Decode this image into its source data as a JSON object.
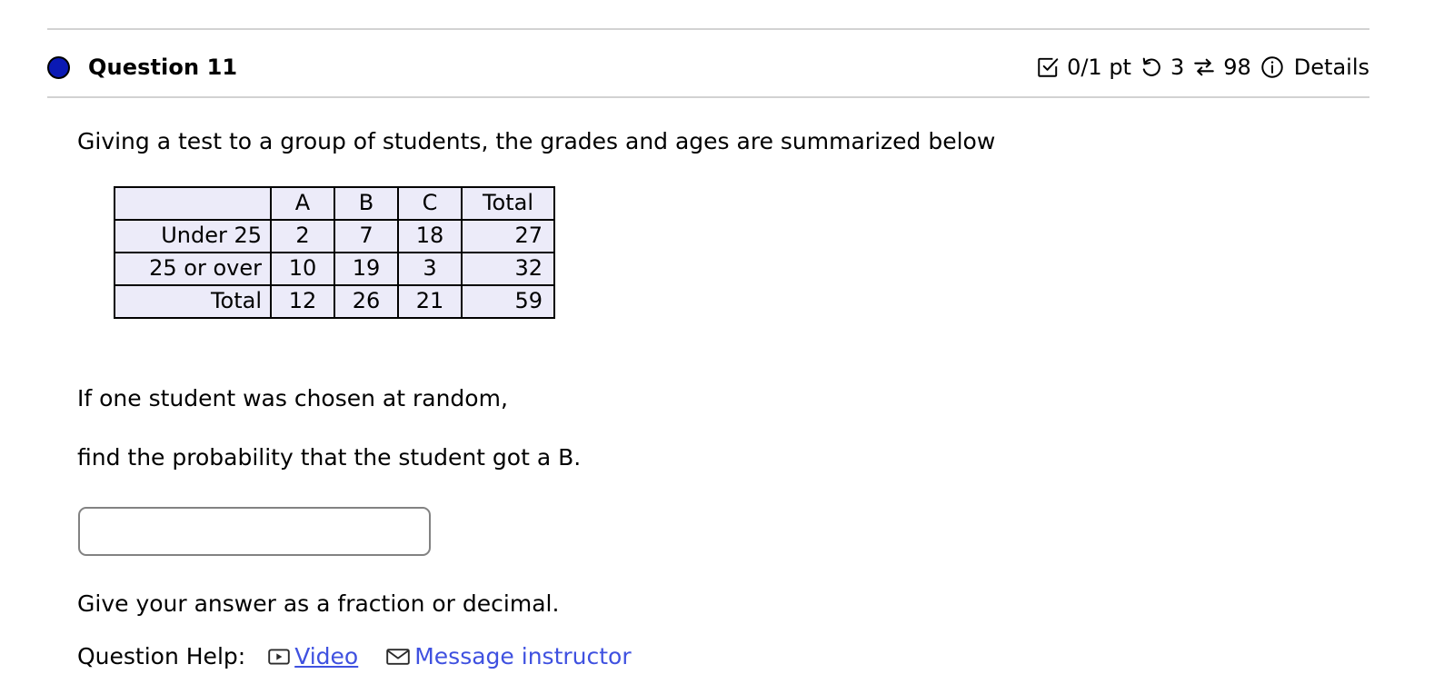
{
  "header": {
    "bullet_color": "#0a19b4",
    "title": "Question 11",
    "score": "0/1 pt",
    "attempts": "3",
    "views": "98",
    "details_label": "Details",
    "icons": {
      "score": "checkbox-checked-icon",
      "attempts": "undo-circular-arrow-icon",
      "views": "exchange-arrows-icon",
      "details": "info-circle-icon"
    }
  },
  "body": {
    "prompt": "Giving a test to a group of students, the grades and ages are summarized below",
    "question_line_1": "If one student was chosen at random,",
    "question_line_2": "find the probability that the student got a B.",
    "hint": "Give your answer as a fraction or decimal."
  },
  "table": {
    "cell_background": "#ecebf9",
    "corner": "",
    "columns": [
      "A",
      "B",
      "C",
      "Total"
    ],
    "rows": [
      {
        "label": "Under 25",
        "values": [
          "2",
          "7",
          "18"
        ],
        "total": "27"
      },
      {
        "label": "25 or over",
        "values": [
          "10",
          "19",
          "3"
        ],
        "total": "32"
      },
      {
        "label": "Total",
        "values": [
          "12",
          "26",
          "21"
        ],
        "total": "59"
      }
    ]
  },
  "answer": {
    "value": "",
    "placeholder": ""
  },
  "help": {
    "label": "Question Help:",
    "video_label": "Video",
    "message_label": "Message instructor",
    "link_color": "#3f51e0",
    "icons": {
      "video": "video-play-icon",
      "message": "envelope-icon"
    }
  }
}
